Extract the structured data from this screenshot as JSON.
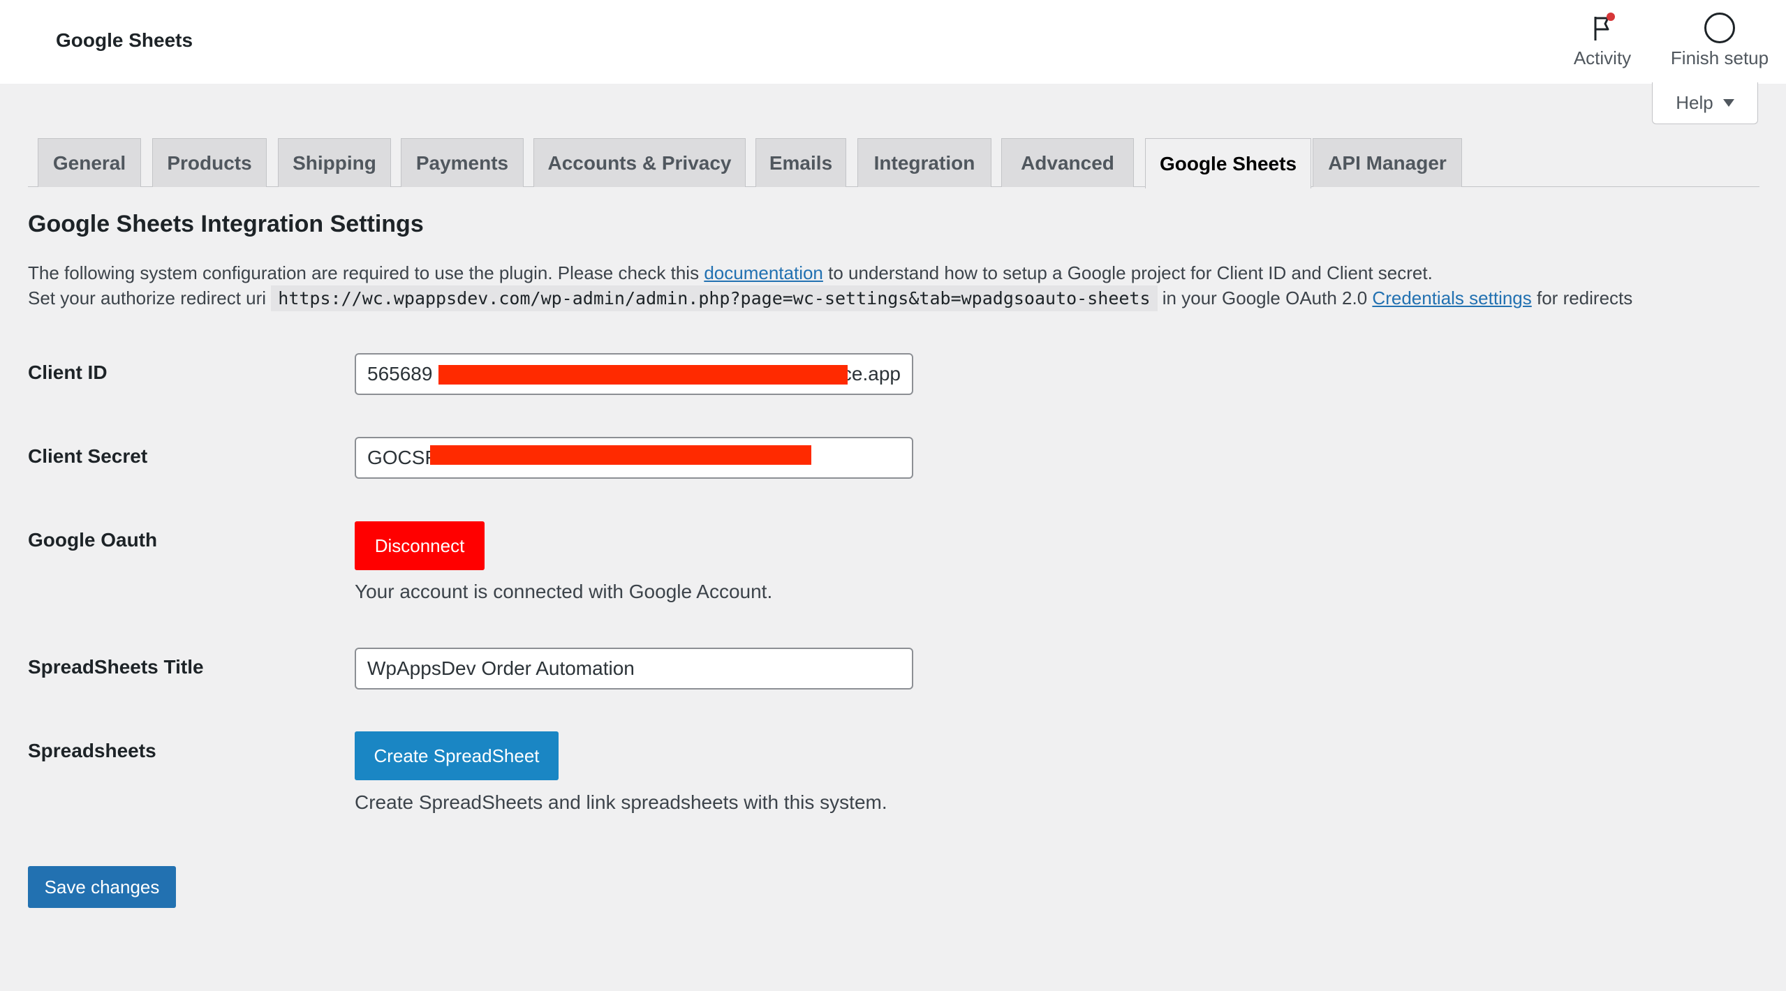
{
  "header": {
    "title": "Google Sheets",
    "activity_label": "Activity",
    "finish_setup_label": "Finish setup"
  },
  "help": {
    "label": "Help"
  },
  "tabs": [
    {
      "label": "General"
    },
    {
      "label": "Products"
    },
    {
      "label": "Shipping"
    },
    {
      "label": "Payments"
    },
    {
      "label": "Accounts & Privacy"
    },
    {
      "label": "Emails"
    },
    {
      "label": "Integration"
    },
    {
      "label": "Advanced"
    },
    {
      "label": "Google Sheets",
      "active": true
    },
    {
      "label": "API Manager"
    }
  ],
  "content": {
    "title": "Google Sheets Integration Settings",
    "desc_line1_before": "The following system configuration are required to use the plugin. Please check this",
    "desc_line1_link": "documentation",
    "desc_line1_after": "to understand how to setup a Google project for Client ID and Client secret.",
    "desc_line2_before": "Set your authorize redirect uri",
    "redirect_uri": "https://wc.wpappsdev.com/wp-admin/admin.php?page=wc-settings&tab=wpadgsoauto-sheets",
    "desc_line2_middle": "in your Google OAuth 2.0",
    "desc_line2_link": "Credentials settings",
    "desc_line2_after": "for redirects"
  },
  "fields": {
    "client_id": {
      "label": "Client ID",
      "value_start": "565689",
      "value_end": "ce.app"
    },
    "client_secret": {
      "label": "Client Secret",
      "value_start": "GOCSF"
    },
    "google_oauth": {
      "label": "Google Oauth",
      "button": "Disconnect",
      "note": "Your account is connected with Google Account."
    },
    "spreadsheet_title": {
      "label": "SpreadSheets Title",
      "value": "WpAppsDev Order Automation"
    },
    "spreadsheets": {
      "label": "Spreadsheets",
      "button": "Create SpreadSheet",
      "note": "Create SpreadSheets and link spreadsheets with this system."
    }
  },
  "actions": {
    "save_label": "Save changes"
  },
  "colors": {
    "accent": "#2271b1",
    "danger": "#ff0000",
    "redaction": "#ff2a00",
    "notification_dot": "#d63638"
  },
  "icons": {
    "activity": "flag-icon",
    "finish_setup": "circle-icon",
    "help_caret": "caret-down-icon"
  }
}
